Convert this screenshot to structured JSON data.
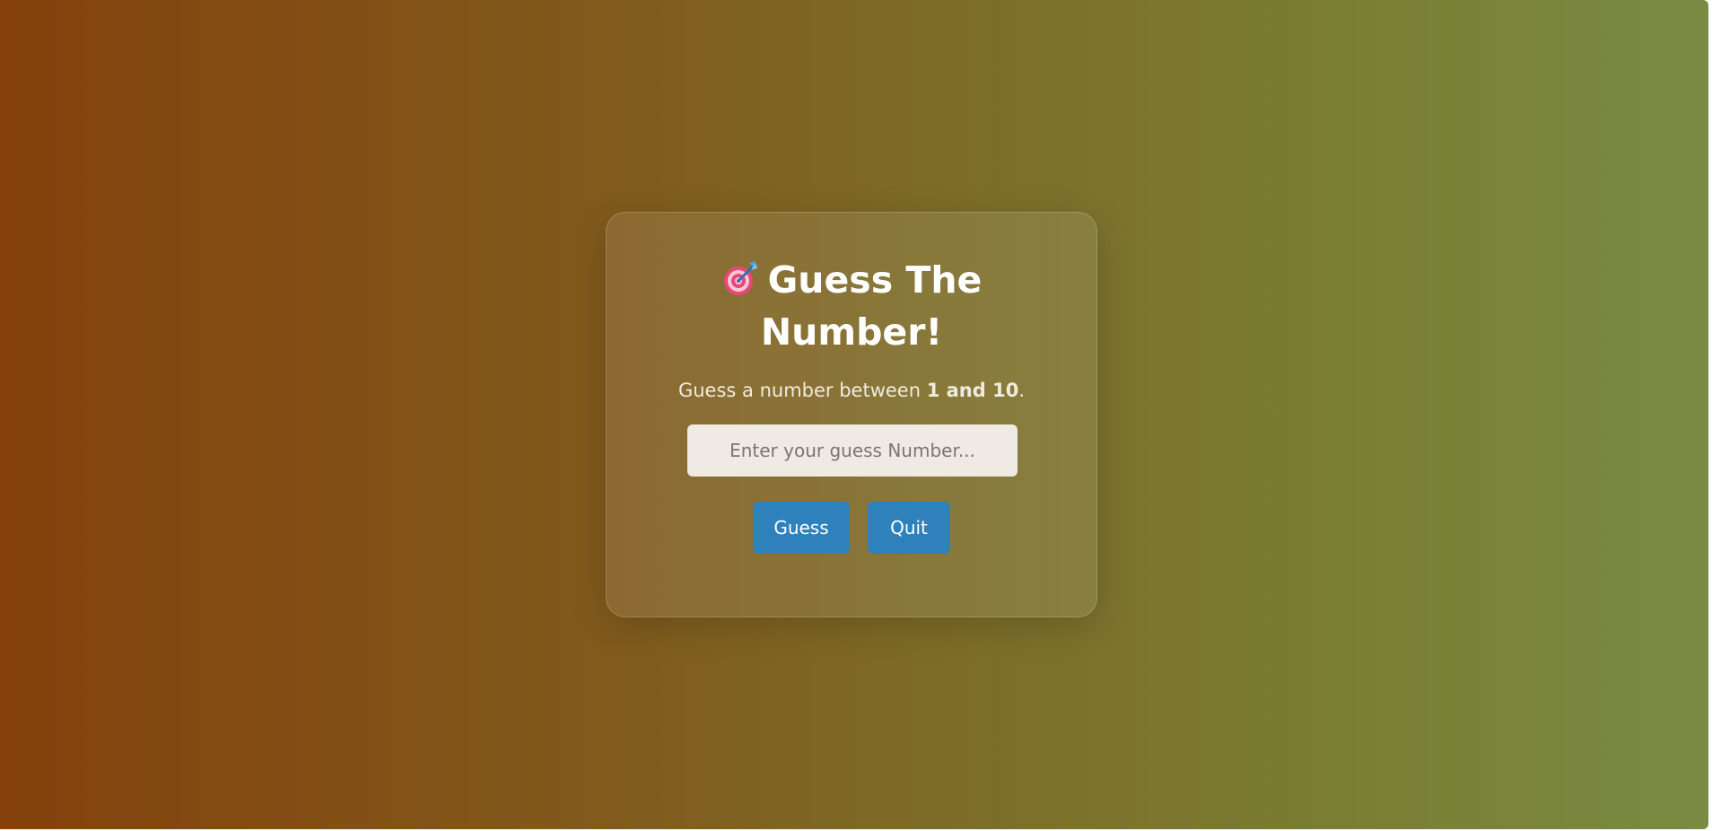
{
  "game": {
    "title_icon": "direct-hit-target-icon",
    "title_line1": "Guess The",
    "title_line2": "Number!",
    "instruction_prefix": "Guess a number between ",
    "instruction_range": "1 and 10",
    "instruction_suffix": ".",
    "input_placeholder": "Enter your guess Number...",
    "input_value": "",
    "guess_button_label": "Guess",
    "quit_button_label": "Quit"
  },
  "colors": {
    "background_start": "#84410c",
    "background_end": "#7a8a42",
    "button": "#2e81bb",
    "input_background": "#efeae3"
  }
}
